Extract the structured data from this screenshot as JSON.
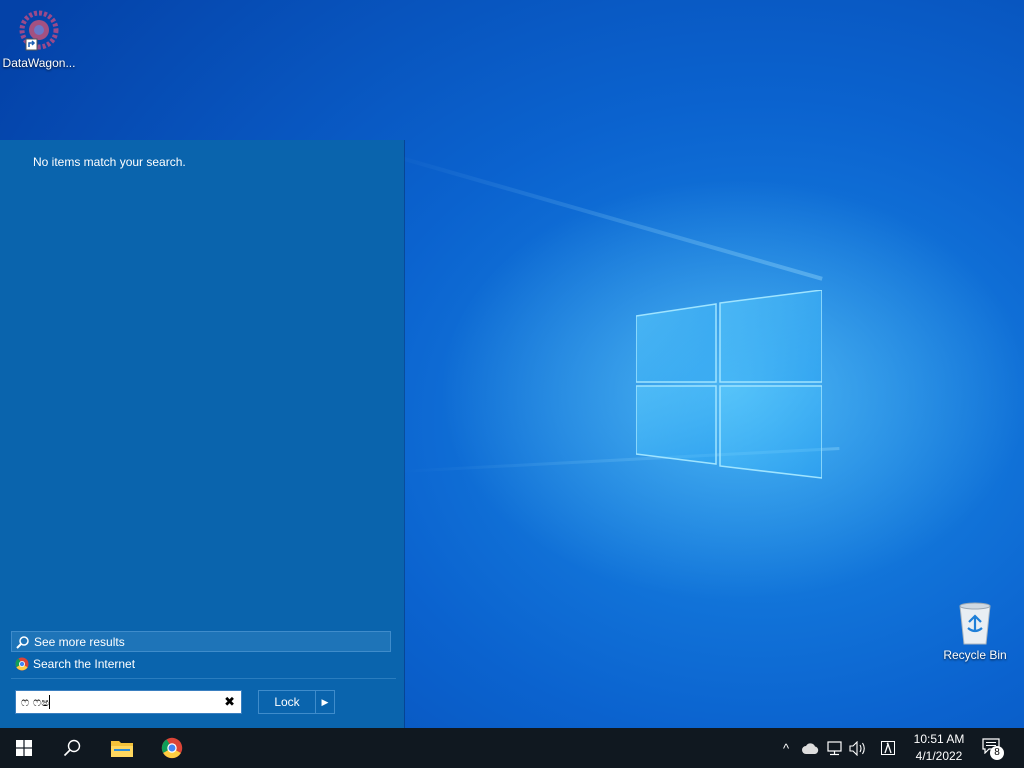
{
  "desktop": {
    "icons": [
      {
        "label": "DataWagon...",
        "icon": "datawagon-shortcut-icon"
      },
      {
        "label": "Recycle Bin",
        "icon": "recycle-bin-icon"
      }
    ]
  },
  "search_panel": {
    "no_items_text": "No items match your search.",
    "see_more_label": "See more results",
    "search_internet_label": "Search the Internet",
    "query": "ෆ ෆෂ",
    "lock_label": "Lock"
  },
  "taskbar": {
    "time": "10:51 AM",
    "date": "4/1/2022",
    "notification_count": "8"
  },
  "colors": {
    "panel": "#0a64ad",
    "taskbar": "#101820",
    "desktop_accent": "#0b63cf"
  }
}
